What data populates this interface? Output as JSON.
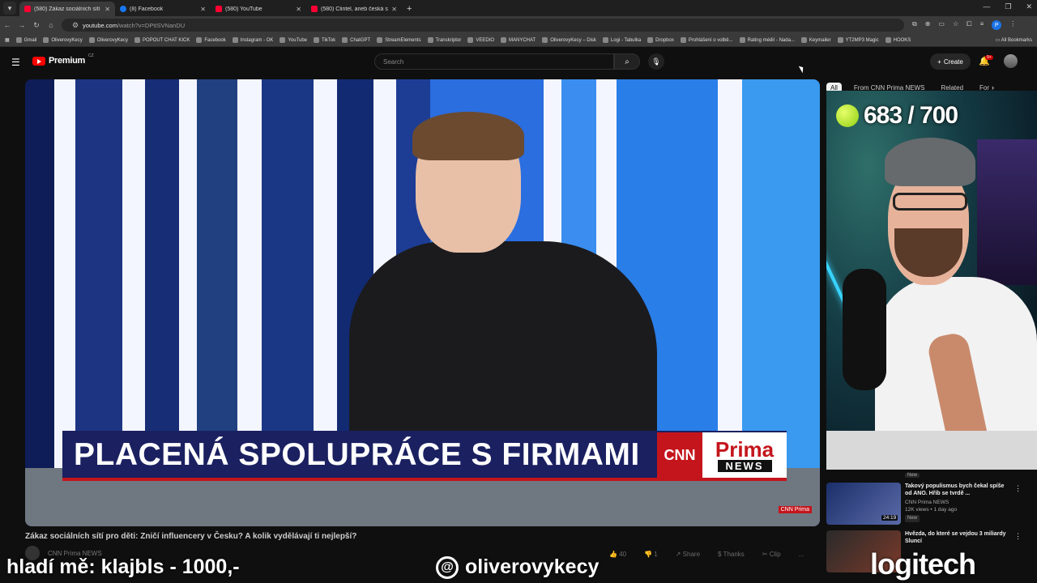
{
  "browser": {
    "tabs": [
      {
        "title": "(580) Zákaz sociálních sítí pro d...",
        "favicon": "youtube-icon",
        "active": true
      },
      {
        "title": "(8) Facebook",
        "favicon": "facebook-icon",
        "active": false
      },
      {
        "title": "(580) YouTube",
        "favicon": "youtube-icon",
        "active": false
      },
      {
        "title": "(580) Clintel, aneb česká stopa...",
        "favicon": "youtube-icon",
        "active": false
      }
    ],
    "url_host": "youtube.com",
    "url_rest": "/watch?v=DPtISVNanDU",
    "profile_initial": "P",
    "bookmarks": [
      "Gmail",
      "OliverovyKecy",
      "OliverovyKecy",
      "POPOUT CHAT KICK",
      "Facebook",
      "Instagram - OK",
      "YouTube",
      "TikTok",
      "ChatGPT",
      "StreamElements",
      "Transkriptor",
      "VEEDIO",
      "MANYCHAT",
      "OliverovyKecy – Disk",
      "Logi - Tabulka",
      "Dropbox",
      "Prohlášení o volbě...",
      "Rating médií - Nada...",
      "Keymailer",
      "YT2MP3 Magic",
      "HOOKS"
    ],
    "all_bookmarks": "All Bookmarks"
  },
  "youtube": {
    "logo": "Premium",
    "logo_region": "CZ",
    "search_placeholder": "Search",
    "create_label": "Create",
    "notifications_badge": "9+",
    "video": {
      "lower_third": "PLACENÁ SPOLUPRÁCE S FIRMAMI",
      "brand_cnn": "CNN",
      "brand_prima": "Prima",
      "brand_news": "NEWS",
      "watermark": "CNN Prima"
    },
    "video_title": "Zákaz sociálních sítí pro děti: Zničí influencery v Česku? A kolik vydělávají ti nejlepší?",
    "channel": "CNN Prima NEWS",
    "actions": {
      "likes": "40",
      "dislikes": "1",
      "share": "Share",
      "thanks": "Thanks",
      "clip": "Clip",
      "more": "..."
    },
    "chips": [
      "All",
      "From CNN Prima NEWS",
      "Related",
      "For"
    ],
    "sidebar": [
      {
        "title": "Takový populismus bych čekal spíše od ANO. Hřib se tvrdě ...",
        "channel": "CNN Prima NEWS",
        "meta": "12K views • 1 day ago",
        "badge": "New",
        "duration": "24:19"
      },
      {
        "title": "Hvězda, do které se vejdou 3 miliardy Sluncí",
        "channel": "",
        "meta": "",
        "badge": "",
        "duration": ""
      }
    ],
    "top_new_badge": "New",
    "top_duration": "24:01"
  },
  "stream": {
    "counter": "683 / 700",
    "left_text": "hladí mě: klajbls - 1000,-",
    "handle": "oliverovykecy",
    "sponsor": "logitech"
  }
}
